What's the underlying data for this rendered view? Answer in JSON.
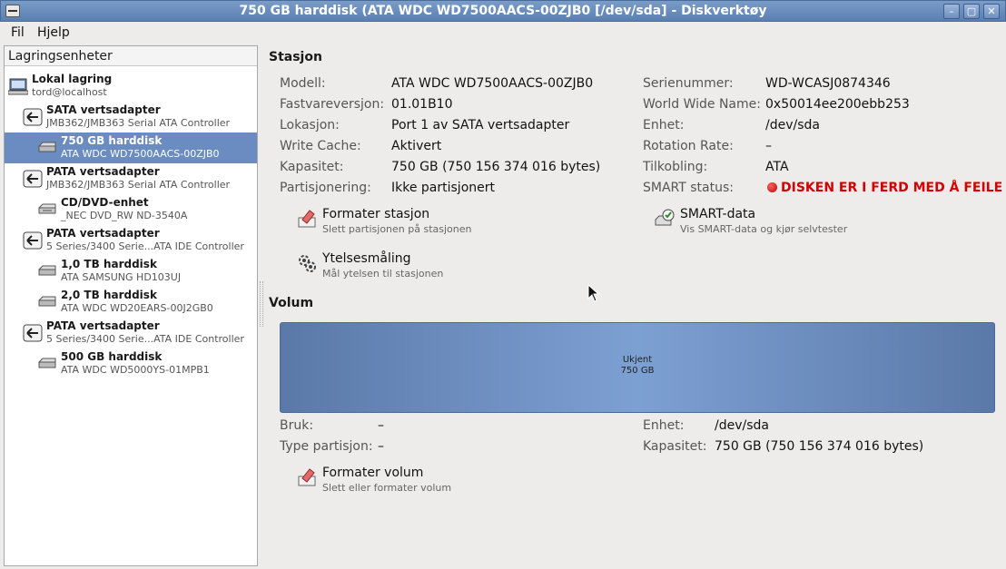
{
  "window": {
    "title": "750 GB harddisk (ATA WDC WD7500AACS-00ZJB0 [/dev/sda] - Diskverktøy"
  },
  "menu": [
    "Fil",
    "Hjelp"
  ],
  "sidebar": {
    "header": "Lagringsenheter",
    "items": [
      {
        "title": "Lokal lagring",
        "sub": "tord@localhost",
        "icon": "computer-icon"
      },
      {
        "title": "SATA vertsadapter",
        "sub": "JMB362/JMB363 Serial ATA Controller",
        "icon": "host-adapter-icon"
      },
      {
        "title": "750 GB harddisk",
        "sub": "ATA WDC WD7500AACS-00ZJB0",
        "icon": "harddisk-icon"
      },
      {
        "title": "PATA vertsadapter",
        "sub": "JMB362/JMB363 Serial ATA Controller",
        "icon": "host-adapter-icon"
      },
      {
        "title": "CD/DVD-enhet",
        "sub": "_NEC DVD_RW ND-3540A",
        "icon": "optical-drive-icon"
      },
      {
        "title": "PATA vertsadapter",
        "sub": "5 Series/3400 Serie...ATA IDE Controller",
        "icon": "host-adapter-icon"
      },
      {
        "title": "1,0 TB harddisk",
        "sub": "ATA SAMSUNG HD103UJ",
        "icon": "harddisk-icon"
      },
      {
        "title": "2,0 TB harddisk",
        "sub": "ATA WDC WD20EARS-00J2GB0",
        "icon": "harddisk-icon"
      },
      {
        "title": "PATA vertsadapter",
        "sub": "5 Series/3400 Serie...ATA IDE Controller",
        "icon": "host-adapter-icon"
      },
      {
        "title": "500 GB harddisk",
        "sub": "ATA WDC WD5000YS-01MPB1",
        "icon": "harddisk-icon"
      }
    ]
  },
  "drive": {
    "section_title": "Stasjon",
    "left": [
      {
        "label": "Modell:",
        "value": "ATA WDC WD7500AACS-00ZJB0"
      },
      {
        "label": "Fastvareversjon:",
        "value": "01.01B10"
      },
      {
        "label": "Lokasjon:",
        "value": "Port 1 av SATA vertsadapter"
      },
      {
        "label": "Write Cache:",
        "value": "Aktivert"
      },
      {
        "label": "Kapasitet:",
        "value": "750 GB (750 156 374 016 bytes)"
      },
      {
        "label": "Partisjonering:",
        "value": "Ikke partisjonert"
      }
    ],
    "right": [
      {
        "label": "Serienummer:",
        "value": "WD-WCASJ0874346"
      },
      {
        "label": "World Wide Name:",
        "value": "0x50014ee200ebb253"
      },
      {
        "label": "Enhet:",
        "value": "/dev/sda"
      },
      {
        "label": "Rotation Rate:",
        "value": "–"
      },
      {
        "label": "Tilkobling:",
        "value": "ATA"
      },
      {
        "label": "SMART status:",
        "value": "DISKEN ER I FERD MED Å FEILE"
      }
    ],
    "actions": {
      "format": {
        "title": "Formater stasjon",
        "sub": "Slett partisjonen på stasjonen"
      },
      "smart": {
        "title": "SMART-data",
        "sub": "Vis SMART-data og kjør selvtester"
      },
      "benchmark": {
        "title": "Ytelsesmåling",
        "sub": "Mål ytelsen til stasjonen"
      }
    },
    "status_color": "#d40000"
  },
  "volume": {
    "section_title": "Volum",
    "bar_label": "Ukjent",
    "bar_size": "750 GB",
    "left": [
      {
        "label": "Bruk:",
        "value": "–"
      },
      {
        "label": "Type partisjon:",
        "value": "–"
      }
    ],
    "right": [
      {
        "label": "Enhet:",
        "value": "/dev/sda"
      },
      {
        "label": "Kapasitet:",
        "value": "750 GB (750 156 374 016 bytes)"
      }
    ],
    "actions": {
      "format": {
        "title": "Formater volum",
        "sub": "Slett eller formater volum"
      }
    }
  }
}
